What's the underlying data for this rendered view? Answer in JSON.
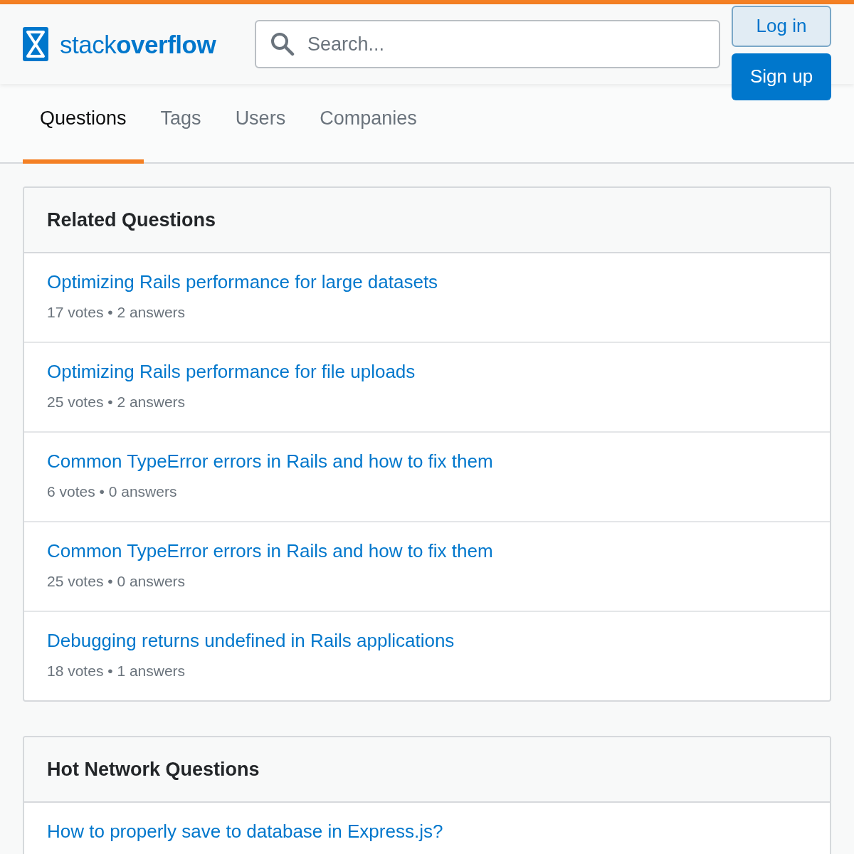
{
  "header": {
    "logo": "stack**overflow**",
    "search": {
      "placeholder": "Search..."
    },
    "buttons": [
      {
        "label": "Log in",
        "kind": "secondary"
      },
      {
        "label": "Sign up",
        "kind": "primary"
      }
    ]
  },
  "tabs": [
    {
      "label": "Questions",
      "selected": true
    },
    {
      "label": "Tags",
      "selected": false
    },
    {
      "label": "Users",
      "selected": false
    },
    {
      "label": "Companies",
      "selected": false
    }
  ],
  "sections": [
    {
      "title": "Related Questions",
      "questions": [
        {
          "title": "Optimizing Rails performance for large datasets",
          "meta": "17 votes • 2 answers"
        },
        {
          "title": "Optimizing Rails performance for file uploads",
          "meta": "25 votes • 2 answers"
        },
        {
          "title": "Common TypeError errors in Rails and how to fix them",
          "meta": "6 votes • 0 answers"
        },
        {
          "title": "Common TypeError errors in Rails and how to fix them",
          "meta": "25 votes • 0 answers"
        },
        {
          "title": "Debugging returns undefined in Rails applications",
          "meta": "18 votes • 1 answers"
        }
      ]
    },
    {
      "title": "Hot Network Questions",
      "questions": [
        {
          "title": "How to properly save to database in Express.js?"
        }
      ]
    }
  ]
}
